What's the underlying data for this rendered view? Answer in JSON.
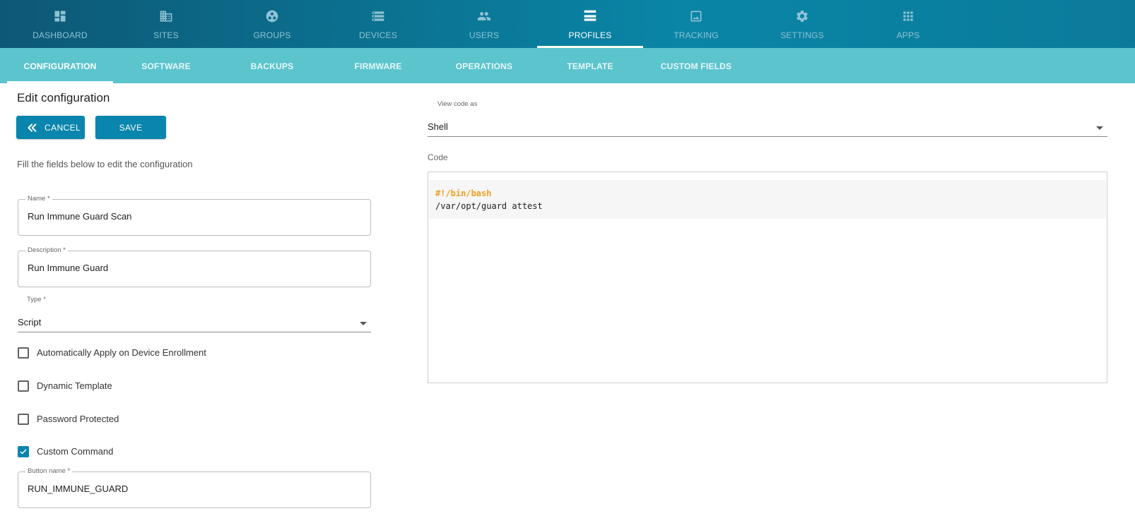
{
  "topnav": {
    "items": [
      {
        "label": "DASHBOARD",
        "icon": "dashboard-icon"
      },
      {
        "label": "SITES",
        "icon": "building-icon"
      },
      {
        "label": "GROUPS",
        "icon": "groups-icon"
      },
      {
        "label": "DEVICES",
        "icon": "devices-icon"
      },
      {
        "label": "USERS",
        "icon": "users-icon"
      },
      {
        "label": "PROFILES",
        "icon": "profiles-icon",
        "active": true
      },
      {
        "label": "TRACKING",
        "icon": "tracking-icon"
      },
      {
        "label": "SETTINGS",
        "icon": "gear-icon"
      },
      {
        "label": "APPS",
        "icon": "apps-grid-icon"
      }
    ]
  },
  "subnav": {
    "tabs": [
      {
        "label": "CONFIGURATION",
        "active": true
      },
      {
        "label": "SOFTWARE"
      },
      {
        "label": "BACKUPS"
      },
      {
        "label": "FIRMWARE"
      },
      {
        "label": "OPERATIONS"
      },
      {
        "label": "TEMPLATE"
      },
      {
        "label": "CUSTOM FIELDS"
      }
    ]
  },
  "form": {
    "title": "Edit configuration",
    "cancel_label": "CANCEL",
    "save_label": "SAVE",
    "helper": "Fill the fields below to edit the configuration",
    "name": {
      "label": "Name *",
      "value": "Run Immune Guard Scan"
    },
    "description": {
      "label": "Description *",
      "value": "Run Immune Guard"
    },
    "type": {
      "label": "Type *",
      "value": "Script"
    },
    "checkboxes": [
      {
        "label": "Automatically Apply on Device Enrollment",
        "checked": false
      },
      {
        "label": "Dynamic Template",
        "checked": false
      },
      {
        "label": "Password Protected",
        "checked": false
      },
      {
        "label": "Custom Command",
        "checked": true
      }
    ],
    "button_name": {
      "label": "Button name *",
      "value": "RUN_IMMUNE_GUARD"
    }
  },
  "code_panel": {
    "view_as_label": "View code as",
    "view_as_value": "Shell",
    "code_label": "Code",
    "lines": [
      "#!/bin/bash",
      "/var/opt/guard attest"
    ]
  },
  "colors": {
    "primary": "#0a85ad",
    "subnav": "#5bc4cd",
    "code_comment": "#f0a020"
  }
}
